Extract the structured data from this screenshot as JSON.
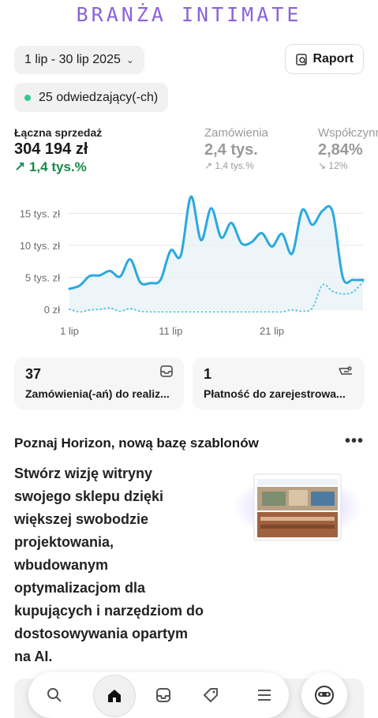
{
  "brand": "BRANŻA INTIMATE",
  "toolbar": {
    "date_range": "1 lip - 30 lip 2025",
    "report_label": "Raport"
  },
  "visitors": {
    "label": "25 odwiedzający(-ch)",
    "dot_color": "#2ecc8f"
  },
  "metrics": [
    {
      "label": "Łączna sprzedaż",
      "value": "304 194 zł",
      "change": "↗ 1,4 tys.%"
    },
    {
      "label": "Zamówienia",
      "value": "2,4 tys.",
      "change": "↗ 1,4 tys.%"
    },
    {
      "label": "Współczynnik",
      "value": "2,84%",
      "change": "↘ 12%"
    }
  ],
  "chart_data": {
    "type": "line",
    "x": [
      1,
      2,
      3,
      4,
      5,
      6,
      7,
      8,
      9,
      10,
      11,
      12,
      13,
      14,
      15,
      16,
      17,
      18,
      19,
      20,
      21,
      22,
      23,
      24,
      25,
      26,
      27,
      28,
      29,
      30
    ],
    "x_ticks": [
      "1 lip",
      "11 lip",
      "21 lip"
    ],
    "x_tick_values": [
      1,
      11,
      21
    ],
    "y_ticks": [
      "15 tys. zł",
      "10 tys. zł",
      "5 tys. zł",
      "0 zł"
    ],
    "y_tick_values": [
      15000,
      10000,
      5000,
      0
    ],
    "ylim": [
      0,
      18000
    ],
    "series": [
      {
        "values": [
          3200,
          3700,
          5200,
          5300,
          6000,
          5100,
          7800,
          4200,
          4100,
          4600,
          9200,
          8400,
          17600,
          10800,
          15800,
          11200,
          13500,
          10300,
          10500,
          11900,
          9800,
          11800,
          8700,
          15500,
          13200,
          15400,
          15200,
          5000,
          4600,
          4600
        ],
        "color": "#2aa9e0",
        "style": "solid"
      },
      {
        "values": [
          0,
          -400,
          -100,
          0,
          200,
          -300,
          100,
          -300,
          -400,
          -400,
          -400,
          -400,
          -400,
          -400,
          -400,
          -400,
          -400,
          -400,
          -400,
          -400,
          -400,
          -400,
          -100,
          -300,
          200,
          3800,
          2800,
          2400,
          2700,
          4300
        ],
        "color": "#56c8e6",
        "style": "dotted"
      }
    ],
    "grid": true
  },
  "cards": [
    {
      "number": "37",
      "text": "Zamówienia(-ań) do realiz...",
      "icon": "inbox-icon"
    },
    {
      "number": "1",
      "text": "Płatność do zarejestrowa...",
      "icon": "cash-icon"
    }
  ],
  "promo": {
    "title": "Poznaj Horizon, nową bazę szablonów",
    "more": "•••",
    "body": "Stwórz wizję witryny swojego sklepu dzięki większej swobodzie projektowania, wbudowanym optymalizacjom dla kupujących i narzędziom do dostosowywania opartym na AI."
  },
  "nav": {
    "items": [
      "search-icon",
      "home-icon",
      "inbox-icon",
      "tag-icon",
      "menu-icon"
    ],
    "active": "home-icon"
  },
  "colors": {
    "brand": "#8a63d8",
    "positive": "#1a8a4a",
    "line": "#2aa9e0"
  }
}
